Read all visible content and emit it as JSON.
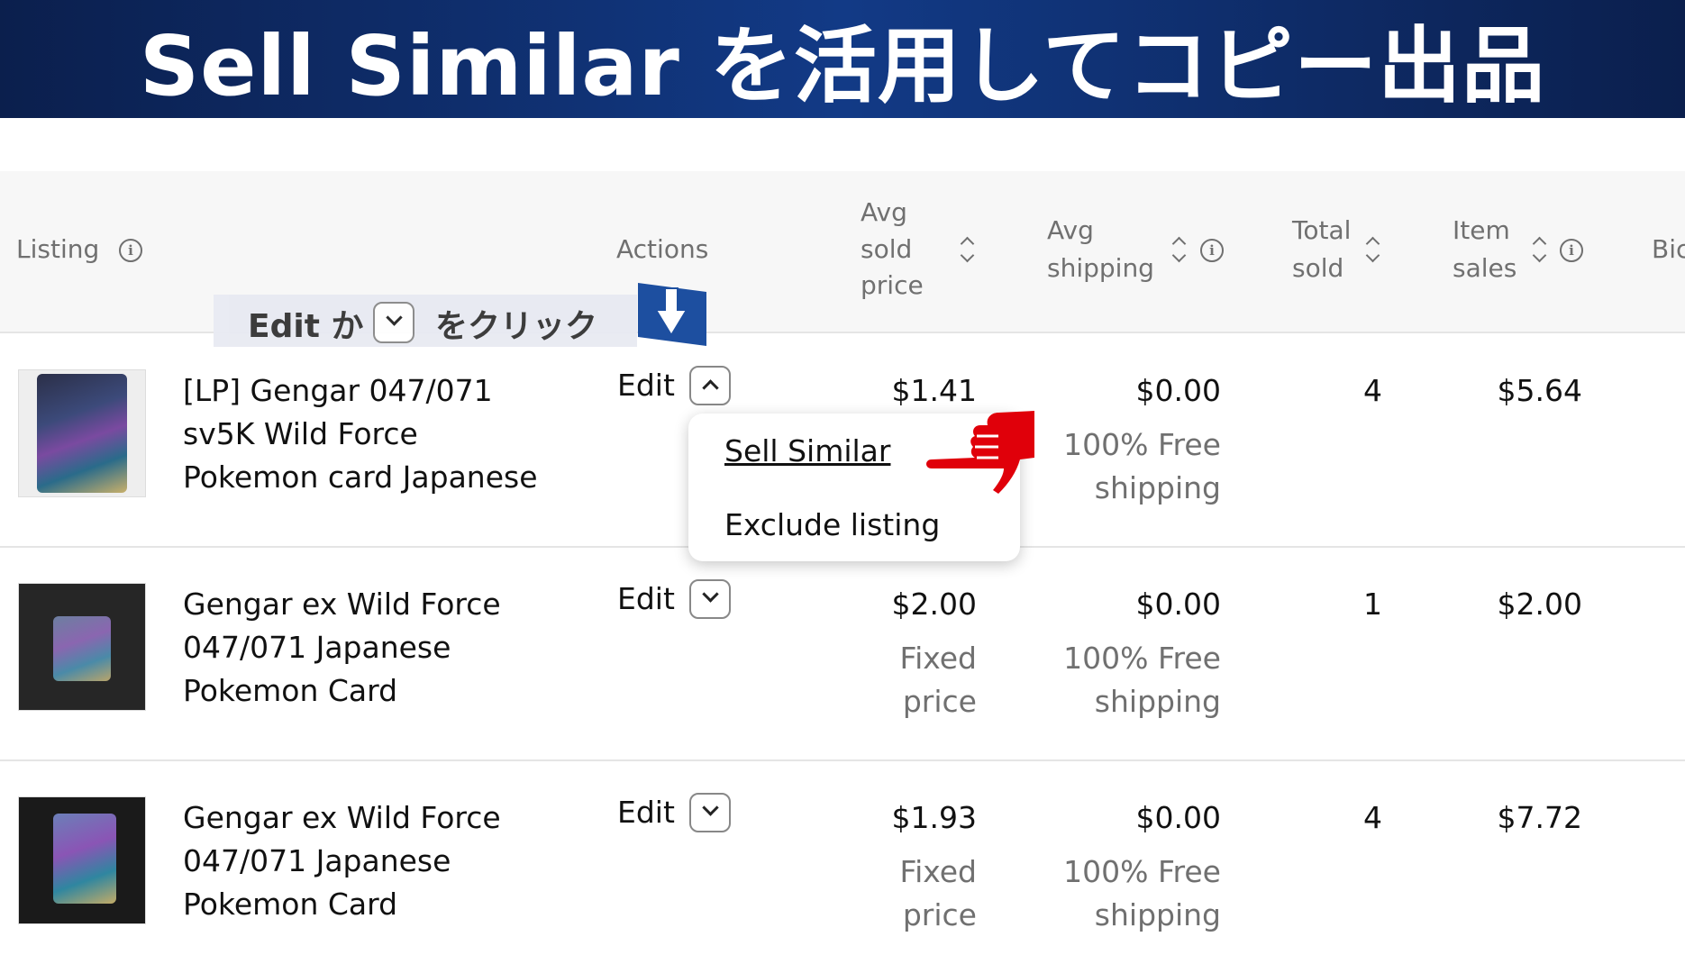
{
  "banner": {
    "title": "Sell Similar を活用してコピー出品"
  },
  "table": {
    "headers": {
      "listing": "Listing",
      "actions": "Actions",
      "avg_sold_price": [
        "Avg",
        "sold",
        "price"
      ],
      "avg_shipping": [
        "Avg",
        "shipping"
      ],
      "total_sold": [
        "Total",
        "sold"
      ],
      "item_sales": [
        "Item",
        "sales"
      ],
      "bid": "Bic"
    },
    "rows": [
      {
        "title_lines": [
          "[LP] Gengar 047/071",
          "sv5K Wild Force",
          "Pokemon card Japanese"
        ],
        "edit_label": "Edit",
        "price": "$1.41",
        "price_sub": [],
        "shipping": "$0.00",
        "shipping_sub": [
          "100% Free",
          "shipping"
        ],
        "total_sold": "4",
        "item_sales": "$5.64"
      },
      {
        "title_lines": [
          "Gengar ex Wild Force",
          "047/071 Japanese",
          "Pokemon Card"
        ],
        "edit_label": "Edit",
        "price": "$2.00",
        "price_sub": [
          "Fixed",
          "price"
        ],
        "shipping": "$0.00",
        "shipping_sub": [
          "100% Free",
          "shipping"
        ],
        "total_sold": "1",
        "item_sales": "$2.00"
      },
      {
        "title_lines": [
          "Gengar ex Wild Force",
          "047/071 Japanese",
          "Pokemon Card"
        ],
        "edit_label": "Edit",
        "price": "$1.93",
        "price_sub": [
          "Fixed",
          "price"
        ],
        "shipping": "$0.00",
        "shipping_sub": [
          "100% Free",
          "shipping"
        ],
        "total_sold": "4",
        "item_sales": "$7.72"
      }
    ]
  },
  "dropdown": {
    "sell_similar": "Sell Similar",
    "exclude_listing": "Exclude listing"
  },
  "instruction": {
    "before": "Edit か",
    "after": "をクリック"
  },
  "colors": {
    "banner": "#123a86",
    "pointer_red": "#e0000a",
    "arrow_box": "#1d4fa0"
  },
  "icons": [
    "info-icon",
    "sort-icon",
    "chevron-down-icon",
    "chevron-up-icon",
    "pointing-hand-icon",
    "down-arrow-icon"
  ]
}
